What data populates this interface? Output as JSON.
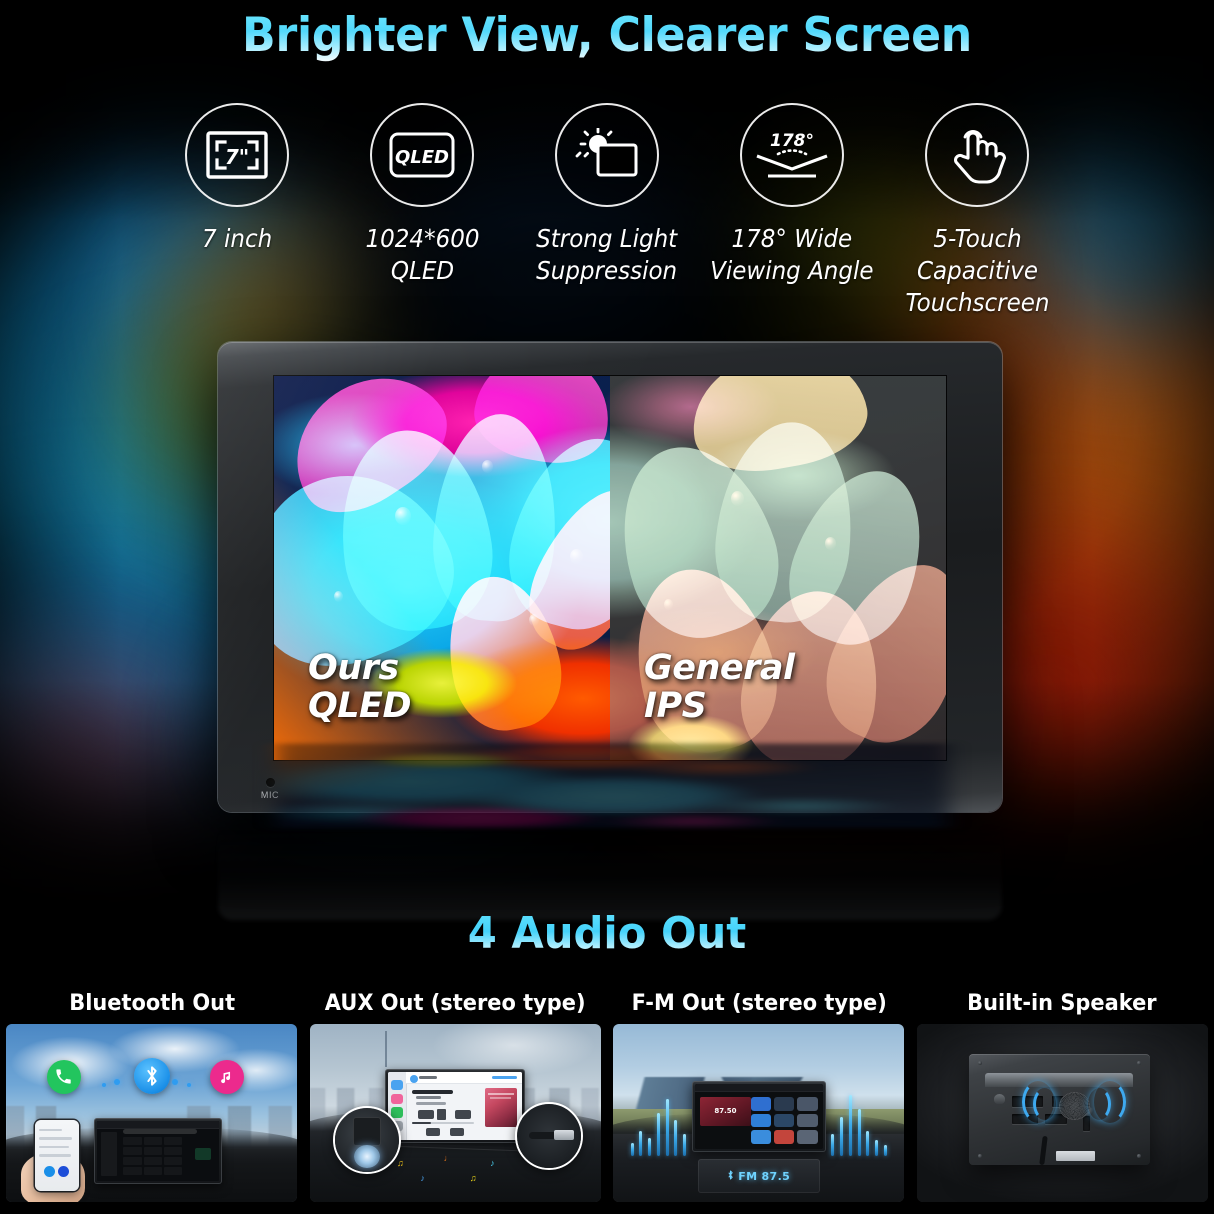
{
  "headline": "Brighter View, Clearer Screen",
  "colors": {
    "accent_cyan": "#52d8fb",
    "headline_gradient_top": "#6fe8ff",
    "headline_gradient_bottom": "#ffffff",
    "bluetooth_blue": "#2f9cf0",
    "call_green": "#22c55e",
    "music_pink": "#ec2a8d",
    "wave_blue": "#3ea9ef",
    "lcd_cyan": "#6fd3ff"
  },
  "features": [
    {
      "icon": "screen-size-icon",
      "badge": "7\"",
      "label": "7 inch"
    },
    {
      "icon": "qled-panel-icon",
      "badge": "QLED",
      "label": "1024*600 QLED"
    },
    {
      "icon": "sun-glare-icon",
      "badge": "",
      "label": "Strong Light\nSuppression"
    },
    {
      "icon": "viewing-angle-icon",
      "badge": "178°",
      "label": "178° Wide\nViewing Angle"
    },
    {
      "icon": "touch-hand-icon",
      "badge": "",
      "label": "5-Touch Capacitive\nTouchscreen"
    }
  ],
  "device": {
    "mic_label": "MIC",
    "screen": {
      "left_caption": "Ours\nQLED",
      "right_caption": "General\nIPS"
    }
  },
  "audio": {
    "title": "4 Audio Out",
    "panels": [
      {
        "label": "Bluetooth Out",
        "icons": [
          "phone-call-icon",
          "bluetooth-icon",
          "music-note-icon"
        ]
      },
      {
        "label": "AUX Out (stereo type)",
        "now_playing_badge": "Playing Next",
        "track_title": "My Forever (Bass Remix)",
        "track_artist": "Merlily Jones",
        "track_album": "My Forever - EP",
        "elapsed": "0:42",
        "remaining": "-2:18"
      },
      {
        "label": "F-M Out (stereo type)",
        "screen_frequency": "87.50",
        "radio_band": "FM",
        "radio_frequency": "87.5"
      },
      {
        "label": "Built-in Speaker"
      }
    ]
  }
}
